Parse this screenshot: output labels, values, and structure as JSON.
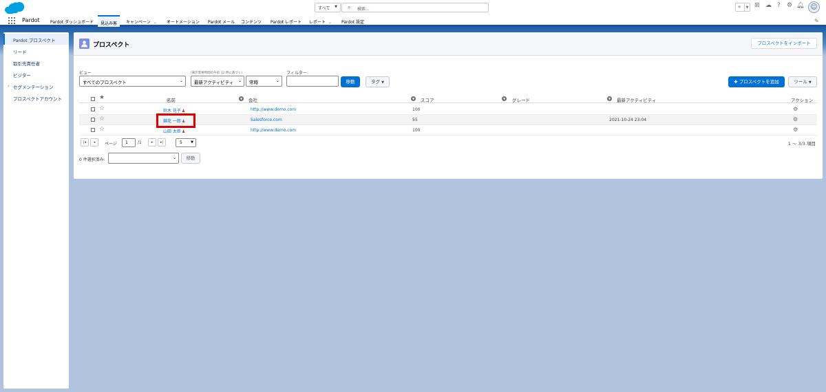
{
  "header": {
    "search_scope": "すべて",
    "search_placeholder": "検索..."
  },
  "nav": {
    "app_name": "Pardot",
    "tabs": [
      {
        "label": "Pardot ダッシュボード",
        "dropdown": false
      },
      {
        "label": "見込み客",
        "dropdown": false,
        "active": true
      },
      {
        "label": "キャンペーン",
        "dropdown": true
      },
      {
        "label": "オートメーション",
        "dropdown": false
      },
      {
        "label": "Pardot メール",
        "dropdown": false
      },
      {
        "label": "コンテンツ",
        "dropdown": false
      },
      {
        "label": "Pardot レポート",
        "dropdown": false
      },
      {
        "label": "レポート",
        "dropdown": true
      },
      {
        "label": "Pardot 設定",
        "dropdown": false
      }
    ]
  },
  "sidebar": {
    "items": [
      {
        "label": "Pardot プロスペクト",
        "active": true
      },
      {
        "label": "リード"
      },
      {
        "label": "取引先責任者"
      },
      {
        "label": "ビジター"
      },
      {
        "label": "セグメンテーション",
        "expandable": true
      },
      {
        "label": "プロスペクトアカウント"
      }
    ]
  },
  "page": {
    "title": "プロスペクト",
    "import_button": "プロスペクトをインポート"
  },
  "filters": {
    "view_label": "ビュー",
    "view_value": "すべてのプロスペクト",
    "date_note": "(来店客要時間の午前 12 時に基づく)",
    "activity_value": "最新アクティビティ",
    "period_value": "常時",
    "filter_label": "フィルター:",
    "go_button": "移動",
    "tag_button": "タグ",
    "add_button": "プロスペクトを追加",
    "tools_button": "ツール"
  },
  "table": {
    "columns": {
      "name": "名前",
      "company": "会社",
      "score": "スコア",
      "grade": "グレード",
      "last_activity": "最新アクティビティ",
      "action": "アクション"
    },
    "rows": [
      {
        "name": "鈴木 花子",
        "company": "http://www.demo.com",
        "score": "100",
        "grade": "",
        "last_activity": ""
      },
      {
        "name": "錦花 一郎",
        "company": "Salesforce.com",
        "score": "55",
        "grade": "",
        "last_activity": "2021-10-24 23:04"
      },
      {
        "name": "山田 太郎",
        "company": "http://www.demo.com",
        "score": "100",
        "grade": "",
        "last_activity": ""
      }
    ]
  },
  "pager": {
    "page_label": "ページ",
    "page_value": "1",
    "page_total": "/1",
    "per_page": "5",
    "count_text": "1 〜 3/3 項目"
  },
  "bulk": {
    "selected_label": "0 件選択済み:",
    "go_button": "移動"
  },
  "colors": {
    "brand_blue": "#0070d2",
    "nav_band": "#1b5297",
    "highlight": "#e00000"
  }
}
